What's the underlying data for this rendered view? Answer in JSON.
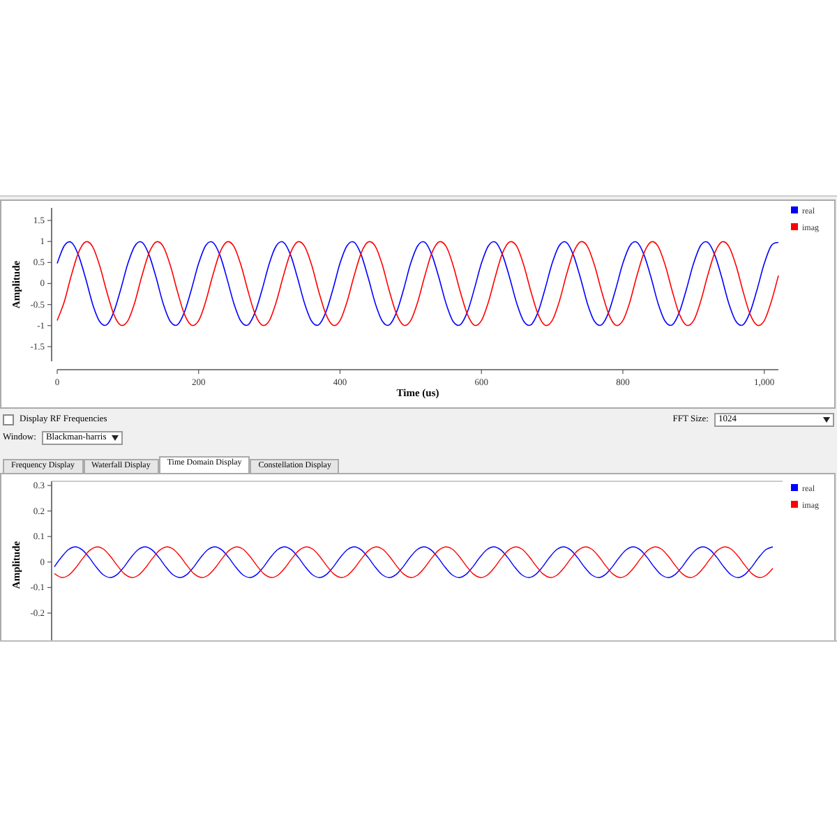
{
  "top_plot": {
    "chart_data": {
      "type": "line",
      "legend": true,
      "xlabel": "Time (us)",
      "ylabel": "Amplitude",
      "xlim": [
        0,
        1020
      ],
      "ylim": [
        -1.85,
        1.8
      ],
      "xticks": [
        0,
        200,
        400,
        600,
        800,
        {
          "value": 1000,
          "label": "1,000"
        }
      ],
      "yticks": [
        -1.5,
        -1,
        -0.5,
        0,
        0.5,
        1,
        1.5
      ],
      "x": [
        0,
        10,
        20,
        30,
        40,
        50,
        60,
        70,
        80,
        90,
        100,
        110,
        120,
        130,
        140,
        150,
        160,
        170,
        180,
        190,
        200,
        210,
        220,
        230,
        240,
        250,
        260,
        270,
        280,
        290,
        300,
        310,
        320,
        330,
        340,
        350,
        360,
        370,
        380,
        390,
        400,
        410,
        420,
        430,
        440,
        450,
        460,
        470,
        480,
        490,
        500,
        510,
        520,
        530,
        540,
        550,
        560,
        570,
        580,
        590,
        600,
        610,
        620,
        630,
        640,
        650,
        660,
        670,
        680,
        690,
        700,
        710,
        720,
        730,
        740,
        750,
        760,
        770,
        780,
        790,
        800,
        810,
        820,
        830,
        840,
        850,
        860,
        870,
        880,
        890,
        900,
        910,
        920,
        930,
        940,
        950,
        960,
        970,
        980,
        990,
        1000,
        1010,
        1020
      ],
      "series": [
        {
          "name": "real",
          "color": "#0000ff",
          "values": [
            0.48,
            0.9,
            0.98,
            0.68,
            0.13,
            -0.48,
            -0.9,
            -0.98,
            -0.68,
            -0.13,
            0.48,
            0.9,
            0.98,
            0.68,
            0.13,
            -0.48,
            -0.9,
            -0.98,
            -0.68,
            -0.13,
            0.48,
            0.9,
            0.98,
            0.68,
            0.13,
            -0.48,
            -0.9,
            -0.98,
            -0.68,
            -0.13,
            0.48,
            0.9,
            0.98,
            0.68,
            0.13,
            -0.48,
            -0.9,
            -0.98,
            -0.68,
            -0.13,
            0.48,
            0.9,
            0.98,
            0.68,
            0.13,
            -0.48,
            -0.9,
            -0.98,
            -0.68,
            -0.13,
            0.48,
            0.9,
            0.98,
            0.68,
            0.13,
            -0.48,
            -0.9,
            -0.98,
            -0.68,
            -0.13,
            0.48,
            0.9,
            0.98,
            0.68,
            0.13,
            -0.48,
            -0.9,
            -0.98,
            -0.68,
            -0.13,
            0.48,
            0.9,
            0.98,
            0.68,
            0.13,
            -0.48,
            -0.9,
            -0.98,
            -0.68,
            -0.13,
            0.48,
            0.9,
            0.98,
            0.68,
            0.13,
            -0.48,
            -0.9,
            -0.98,
            -0.68,
            -0.13,
            0.48,
            0.9,
            0.98,
            0.68,
            0.13,
            -0.48,
            -0.9,
            -0.98,
            -0.68,
            -0.13,
            0.48,
            0.9,
            0.98
          ]
        },
        {
          "name": "imag",
          "color": "#ff0000",
          "values": [
            -0.88,
            -0.43,
            0.19,
            0.73,
            0.99,
            0.88,
            0.43,
            -0.19,
            -0.73,
            -0.99,
            -0.88,
            -0.43,
            0.19,
            0.73,
            0.99,
            0.88,
            0.43,
            -0.19,
            -0.73,
            -0.99,
            -0.88,
            -0.43,
            0.19,
            0.73,
            0.99,
            0.88,
            0.43,
            -0.19,
            -0.73,
            -0.99,
            -0.88,
            -0.43,
            0.19,
            0.73,
            0.99,
            0.88,
            0.43,
            -0.19,
            -0.73,
            -0.99,
            -0.88,
            -0.43,
            0.19,
            0.73,
            0.99,
            0.88,
            0.43,
            -0.19,
            -0.73,
            -0.99,
            -0.88,
            -0.43,
            0.19,
            0.73,
            0.99,
            0.88,
            0.43,
            -0.19,
            -0.73,
            -0.99,
            -0.88,
            -0.43,
            0.19,
            0.73,
            0.99,
            0.88,
            0.43,
            -0.19,
            -0.73,
            -0.99,
            -0.88,
            -0.43,
            0.19,
            0.73,
            0.99,
            0.88,
            0.43,
            -0.19,
            -0.73,
            -0.99,
            -0.88,
            -0.43,
            0.19,
            0.73,
            0.99,
            0.88,
            0.43,
            -0.19,
            -0.73,
            -0.99,
            -0.88,
            -0.43,
            0.19,
            0.73,
            0.99,
            0.88,
            0.43,
            -0.19,
            -0.73,
            -0.99,
            -0.88,
            -0.43,
            0.19
          ]
        }
      ]
    }
  },
  "display_rf_frequencies": {
    "label": "Display RF Frequencies",
    "checked": false
  },
  "fft_size": {
    "label": "FFT Size:",
    "value": "1024"
  },
  "window": {
    "label": "Window:",
    "value": "Blackman-harris"
  },
  "tabs": [
    {
      "label": "Frequency Display",
      "selected": false
    },
    {
      "label": "Waterfall Display",
      "selected": false
    },
    {
      "label": "Time Domain Display",
      "selected": true
    },
    {
      "label": "Constellation Display",
      "selected": false
    }
  ],
  "time_domain_plot": {
    "ylabel": "Amplitude",
    "yticks": [
      "0.3",
      "0.2",
      "0.1",
      "0",
      "-0.1",
      "-0.2"
    ],
    "legend": [
      {
        "name": "real",
        "color": "#0000ff"
      },
      {
        "name": "imag",
        "color": "#ff0000"
      }
    ]
  }
}
